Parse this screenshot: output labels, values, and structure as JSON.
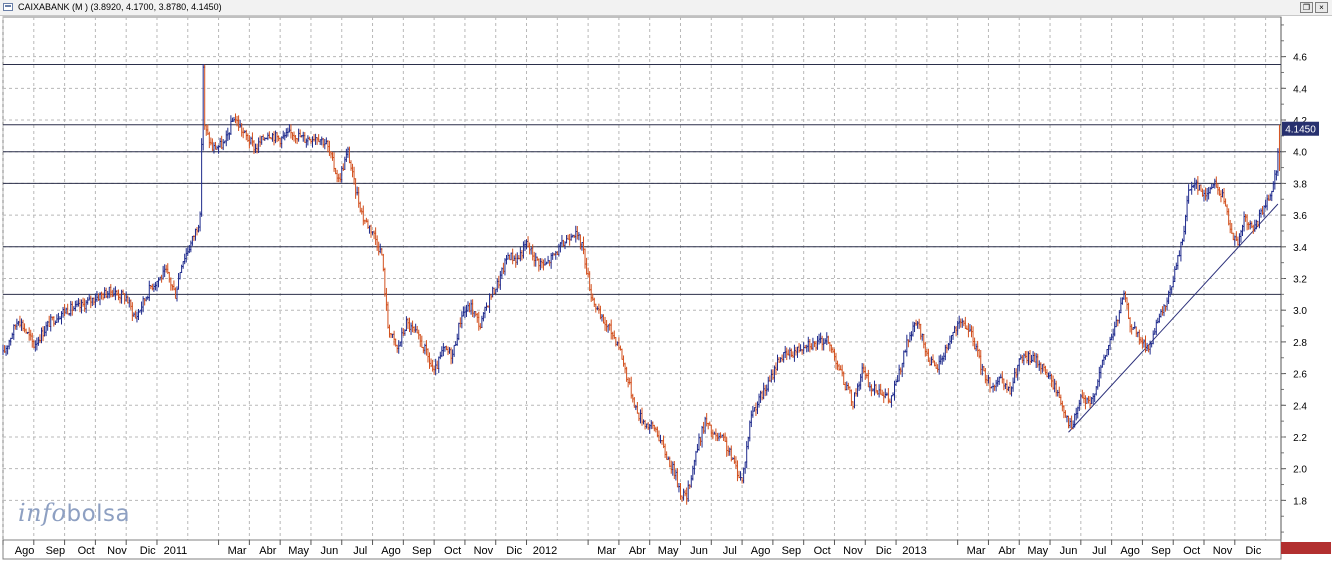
{
  "window": {
    "title": "CAIXABANK (M ) (3.8920, 4.1700, 3.8780, 4.1450)",
    "buttons": [
      "restore",
      "close"
    ]
  },
  "logo": {
    "part1": "info",
    "part2": "bolsa"
  },
  "colors": {
    "up": "#1e2a8c",
    "down": "#d2501e",
    "grid": "#b8b8b8",
    "price_badge_bg": "#27306e",
    "price_badge_text": "#ffffff",
    "bottom_stripe": "#b23030"
  },
  "chart_data": {
    "type": "line",
    "title": "CAIXABANK (M )",
    "ohlc_last": {
      "open": 3.892,
      "high": 4.17,
      "low": 3.878,
      "close": 4.145
    },
    "last_price_label": "4.1450",
    "ylim": [
      1.55,
      4.85
    ],
    "y_ticks": [
      "1.8",
      "2.0",
      "2.2",
      "2.4",
      "2.6",
      "2.8",
      "3.0",
      "3.2",
      "3.4",
      "3.6",
      "3.8",
      "4.0",
      "4.2",
      "4.4",
      "4.6"
    ],
    "x_labels": [
      "Ago",
      "Sep",
      "Oct",
      "Nov",
      "Dic",
      "2011",
      "Mar",
      "Abr",
      "May",
      "Jun",
      "Jul",
      "Ago",
      "Sep",
      "Oct",
      "Nov",
      "Dic",
      "2012",
      "Mar",
      "Abr",
      "May",
      "Jun",
      "Jul",
      "Ago",
      "Sep",
      "Oct",
      "Nov",
      "Dic",
      "2013",
      "Mar",
      "Abr",
      "May",
      "Jun",
      "Jul",
      "Ago",
      "Sep",
      "Oct",
      "Nov",
      "Dic"
    ],
    "x_label_units": [
      0.7,
      1.7,
      2.7,
      3.7,
      4.7,
      5.6,
      7.6,
      8.6,
      9.6,
      10.6,
      11.6,
      12.6,
      13.6,
      14.6,
      15.6,
      16.6,
      17.6,
      19.6,
      20.6,
      21.6,
      22.6,
      23.6,
      24.6,
      25.6,
      26.6,
      27.6,
      28.6,
      29.6,
      31.6,
      32.6,
      33.6,
      34.6,
      35.6,
      36.6,
      37.6,
      38.6,
      39.6,
      40.6
    ],
    "x_range": [
      0,
      41.5
    ],
    "horizontal_lines": [
      4.55,
      4.17,
      4.0,
      3.8,
      3.4,
      3.1
    ],
    "trendline": {
      "from": {
        "x": 34.6,
        "y": 2.23
      },
      "to": {
        "x": 41.4,
        "y": 3.67
      }
    },
    "series": [
      {
        "points": [
          [
            0.0,
            2.72
          ],
          [
            0.5,
            2.95
          ],
          [
            1.0,
            2.78
          ],
          [
            1.5,
            2.92
          ],
          [
            2.0,
            3.0
          ],
          [
            2.5,
            3.02
          ],
          [
            3.0,
            3.08
          ],
          [
            3.5,
            3.12
          ],
          [
            4.0,
            3.08
          ],
          [
            4.3,
            2.95
          ],
          [
            4.8,
            3.15
          ],
          [
            5.3,
            3.24
          ],
          [
            5.6,
            3.1
          ],
          [
            5.8,
            3.3
          ],
          [
            6.1,
            3.42
          ],
          [
            6.4,
            3.58
          ],
          [
            6.5,
            4.54
          ],
          [
            6.55,
            4.15
          ],
          [
            6.8,
            4.02
          ],
          [
            7.2,
            4.05
          ],
          [
            7.5,
            4.22
          ],
          [
            7.8,
            4.12
          ],
          [
            8.2,
            4.02
          ],
          [
            8.6,
            4.12
          ],
          [
            9.0,
            4.08
          ],
          [
            9.4,
            4.12
          ],
          [
            9.8,
            4.08
          ],
          [
            10.2,
            4.1
          ],
          [
            10.5,
            4.05
          ],
          [
            10.9,
            3.82
          ],
          [
            11.2,
            4.0
          ],
          [
            11.4,
            3.8
          ],
          [
            11.7,
            3.58
          ],
          [
            12.0,
            3.5
          ],
          [
            12.3,
            3.35
          ],
          [
            12.5,
            2.9
          ],
          [
            12.8,
            2.75
          ],
          [
            13.1,
            2.92
          ],
          [
            13.4,
            2.85
          ],
          [
            13.7,
            2.75
          ],
          [
            14.0,
            2.6
          ],
          [
            14.3,
            2.75
          ],
          [
            14.6,
            2.72
          ],
          [
            14.9,
            2.98
          ],
          [
            15.2,
            3.02
          ],
          [
            15.5,
            2.9
          ],
          [
            15.8,
            3.08
          ],
          [
            16.1,
            3.18
          ],
          [
            16.4,
            3.35
          ],
          [
            16.7,
            3.32
          ],
          [
            17.0,
            3.42
          ],
          [
            17.3,
            3.32
          ],
          [
            17.6,
            3.28
          ],
          [
            17.9,
            3.35
          ],
          [
            18.2,
            3.42
          ],
          [
            18.5,
            3.5
          ],
          [
            18.8,
            3.42
          ],
          [
            19.1,
            3.1
          ],
          [
            19.4,
            2.95
          ],
          [
            19.7,
            2.88
          ],
          [
            20.0,
            2.78
          ],
          [
            20.3,
            2.55
          ],
          [
            20.6,
            2.35
          ],
          [
            20.9,
            2.28
          ],
          [
            21.2,
            2.25
          ],
          [
            21.5,
            2.1
          ],
          [
            21.8,
            1.98
          ],
          [
            22.0,
            1.85
          ],
          [
            22.2,
            1.82
          ],
          [
            22.5,
            2.1
          ],
          [
            22.8,
            2.3
          ],
          [
            23.1,
            2.2
          ],
          [
            23.4,
            2.18
          ],
          [
            23.7,
            2.05
          ],
          [
            24.0,
            1.92
          ],
          [
            24.3,
            2.35
          ],
          [
            24.6,
            2.45
          ],
          [
            24.9,
            2.55
          ],
          [
            25.2,
            2.7
          ],
          [
            25.5,
            2.72
          ],
          [
            25.8,
            2.75
          ],
          [
            26.1,
            2.8
          ],
          [
            26.4,
            2.78
          ],
          [
            26.7,
            2.82
          ],
          [
            27.0,
            2.72
          ],
          [
            27.3,
            2.55
          ],
          [
            27.6,
            2.42
          ],
          [
            27.9,
            2.62
          ],
          [
            28.2,
            2.5
          ],
          [
            28.5,
            2.5
          ],
          [
            28.8,
            2.42
          ],
          [
            29.1,
            2.6
          ],
          [
            29.4,
            2.82
          ],
          [
            29.7,
            2.92
          ],
          [
            30.0,
            2.72
          ],
          [
            30.3,
            2.62
          ],
          [
            30.6,
            2.75
          ],
          [
            30.9,
            2.88
          ],
          [
            31.2,
            2.92
          ],
          [
            31.5,
            2.82
          ],
          [
            31.8,
            2.62
          ],
          [
            32.1,
            2.52
          ],
          [
            32.4,
            2.55
          ],
          [
            32.7,
            2.48
          ],
          [
            33.0,
            2.68
          ],
          [
            33.3,
            2.7
          ],
          [
            33.6,
            2.68
          ],
          [
            33.9,
            2.6
          ],
          [
            34.2,
            2.5
          ],
          [
            34.5,
            2.35
          ],
          [
            34.7,
            2.25
          ],
          [
            35.0,
            2.45
          ],
          [
            35.3,
            2.4
          ],
          [
            35.6,
            2.6
          ],
          [
            35.9,
            2.78
          ],
          [
            36.2,
            2.95
          ],
          [
            36.4,
            3.1
          ],
          [
            36.6,
            2.92
          ],
          [
            36.9,
            2.82
          ],
          [
            37.2,
            2.75
          ],
          [
            37.5,
            2.92
          ],
          [
            37.8,
            3.05
          ],
          [
            38.1,
            3.28
          ],
          [
            38.3,
            3.45
          ],
          [
            38.5,
            3.75
          ],
          [
            38.7,
            3.82
          ],
          [
            39.0,
            3.72
          ],
          [
            39.3,
            3.8
          ],
          [
            39.6,
            3.72
          ],
          [
            39.9,
            3.5
          ],
          [
            40.1,
            3.4
          ],
          [
            40.3,
            3.58
          ],
          [
            40.6,
            3.5
          ],
          [
            40.9,
            3.62
          ],
          [
            41.1,
            3.72
          ],
          [
            41.25,
            3.8
          ],
          [
            41.35,
            3.9
          ],
          [
            41.45,
            4.145
          ]
        ]
      }
    ]
  }
}
